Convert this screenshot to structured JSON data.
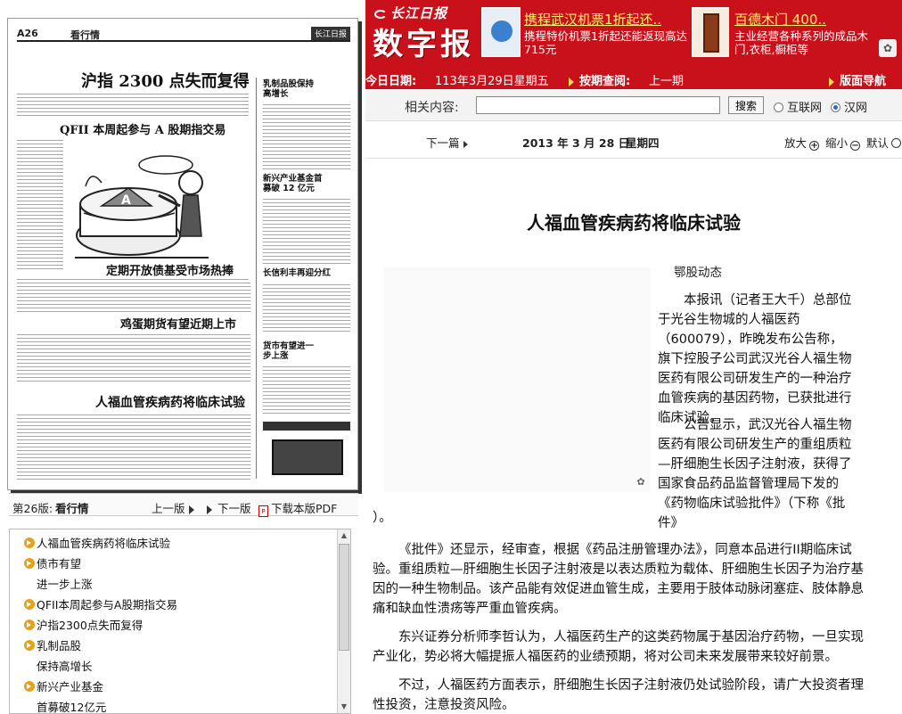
{
  "banner": {
    "small_logo": "长江日报",
    "big_logo": "数字报",
    "ad1": {
      "title": "携程武汉机票1折起还..",
      "desc": "携程特价机票1折起还能返现高达715元"
    },
    "ad2": {
      "title": "百德木门 400..",
      "desc": "主业经营各种系列的成品木门,衣柜,橱柜等"
    }
  },
  "datebar": {
    "today_label": "今日日期:",
    "today_value": "113年3月29日星期五",
    "period_label": "按期查阅:",
    "prev_period": "上一期",
    "page_nav": "版面导航"
  },
  "newspaper": {
    "page_no": "A26",
    "section": "看行情",
    "masthead": "长江日报",
    "headlines": [
      "沪指 2300 点失而复得",
      "QFII 本周起参与 A 股期指交易",
      "定期开放债基受市场热捧",
      "鸡蛋期货有望近期上市",
      "人福血管疾病药将临床试验"
    ],
    "side_headlines": [
      "乳制品股保持高增长",
      "新兴产业基金首募破 12 亿元",
      "长信利丰再迎分红",
      "货市有望进一步上涨"
    ]
  },
  "pagenav": {
    "page_label": "第26版:",
    "page_name": "看行情",
    "prev": "上一版",
    "next": "下一版",
    "pdf": "下载本版PDF"
  },
  "article_list": [
    {
      "title": "人福血管疾病药将临床试验",
      "bullet": true
    },
    {
      "title": "债市有望",
      "bullet": true
    },
    {
      "title": "进一步上涨",
      "bullet": false
    },
    {
      "title": "QFII本周起参与A股期指交易",
      "bullet": true
    },
    {
      "title": "沪指2300点失而复得",
      "bullet": true
    },
    {
      "title": "乳制品股",
      "bullet": true
    },
    {
      "title": "保持高增长",
      "bullet": false
    },
    {
      "title": "新兴产业基金",
      "bullet": true
    },
    {
      "title": "首募破12亿元",
      "bullet": false
    }
  ],
  "search": {
    "label": "相关内容:",
    "placeholder": "",
    "button": "搜索",
    "option_web": "互联网",
    "option_hanwang": "汉网",
    "selected": "汉网"
  },
  "toolbar": {
    "next_article": "下一篇",
    "date": "2013 年 3 月 28 日",
    "weekday": "星期四",
    "zoom_in": "放大",
    "zoom_out": "缩小",
    "default": "默认"
  },
  "article": {
    "title": "人福血管疾病药将临床试验",
    "source": "鄂股动态",
    "p1": "本报讯（记者王大千）总部位于光谷生物城的人福医药（600079），昨晚发布公告称，旗下控股子公司武汉光谷人福生物医药有限公司研发生产的一种治疗血管疾病的基因药物，已获批进行临床试验。",
    "p2": "公告显示，武汉光谷人福生物医药有限公司研发生产的重组质粒—肝细胞生长因子注射液，获得了国家食品药品监督管理局下发的《药物临床试验批件》（下称《批件》",
    "p2_tail": "）。",
    "p3": "《批件》还显示，经审查，根据《药品注册管理办法》，同意本品进行II期临床试验。重组质粒—肝细胞生长因子注射液是以表达质粒为载体、肝细胞生长因子为治疗基因的一种生物制品。该产品能有效促进血管生成，主要用于肢体动脉闭塞症、肢体静息痛和缺血性溃疡等严重血管疾病。",
    "p4": "东兴证券分析师李哲认为，人福医药生产的这类药物属于基因治疗药物，一旦实现产业化，势必将大幅提振人福医药的业绩预期，将对公司未来发展带来较好前景。",
    "p5": "不过，人福医药方面表示，肝细胞生长因子注射液仍处试验阶段，请广大投资者理性投资，注意投资风险。"
  },
  "colors": {
    "brand_red": "#c8111b",
    "link_yellow": "#ffef6a",
    "bullet": "#e3a21a"
  }
}
